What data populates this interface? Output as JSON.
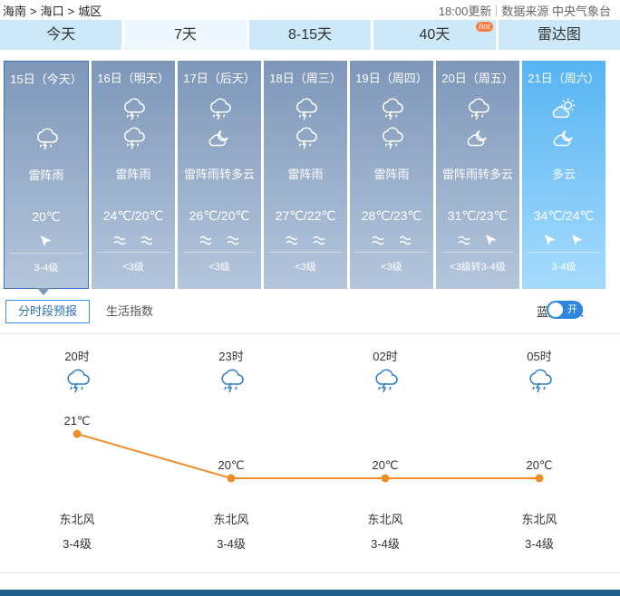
{
  "breadcrumb": {
    "province": "海南",
    "city": "海口",
    "district": "城区",
    "separator": ">"
  },
  "meta": {
    "updated": "18:00更新",
    "source": "数据来源 中央气象台"
  },
  "tabs": [
    {
      "label": "今天",
      "active": false
    },
    {
      "label": "7天",
      "active": true
    },
    {
      "label": "8-15天",
      "active": false
    },
    {
      "label": "40天",
      "active": false,
      "badge": "hot"
    },
    {
      "label": "雷达图",
      "active": false
    }
  ],
  "days": [
    {
      "date": "15日（今天）",
      "icons": [
        "thunder-rain-icon"
      ],
      "desc": "雷阵雨",
      "temp": "20℃",
      "winds": [
        "wind-arrow-icon"
      ],
      "level": "3-4级",
      "selected": true,
      "fine": false
    },
    {
      "date": "16日（明天）",
      "icons": [
        "thunder-rain-icon",
        "thunder-rain-icon"
      ],
      "desc": "雷阵雨",
      "temp": "24℃/20℃",
      "winds": [
        "wind-wave-icon",
        "wind-wave-icon"
      ],
      "level": "<3级",
      "selected": false,
      "fine": false
    },
    {
      "date": "17日（后天）",
      "icons": [
        "thunder-rain-icon",
        "cloud-moon-icon"
      ],
      "desc": "雷阵雨转多云",
      "temp": "26℃/20℃",
      "winds": [
        "wind-wave-icon",
        "wind-wave-icon"
      ],
      "level": "<3级",
      "selected": false,
      "fine": false
    },
    {
      "date": "18日（周三）",
      "icons": [
        "thunder-rain-icon",
        "thunder-rain-icon"
      ],
      "desc": "雷阵雨",
      "temp": "27℃/22℃",
      "winds": [
        "wind-wave-icon",
        "wind-wave-icon"
      ],
      "level": "<3级",
      "selected": false,
      "fine": false
    },
    {
      "date": "19日（周四）",
      "icons": [
        "thunder-rain-icon",
        "thunder-rain-icon"
      ],
      "desc": "雷阵雨",
      "temp": "28℃/23℃",
      "winds": [
        "wind-wave-icon",
        "wind-wave-icon"
      ],
      "level": "<3级",
      "selected": false,
      "fine": false
    },
    {
      "date": "20日（周五）",
      "icons": [
        "thunder-rain-icon",
        "cloud-moon-icon"
      ],
      "desc": "雷阵雨转多云",
      "temp": "31℃/23℃",
      "winds": [
        "wind-wave-icon",
        "wind-arrow-icon"
      ],
      "level": "<3级转3-4级",
      "selected": false,
      "fine": false
    },
    {
      "date": "21日（周六）",
      "icons": [
        "cloud-sun-icon",
        "cloud-moon-icon"
      ],
      "desc": "多云",
      "temp": "34℃/24℃",
      "winds": [
        "wind-arrow-icon",
        "wind-arrow-icon"
      ],
      "level": "3-4级",
      "selected": false,
      "fine": true
    }
  ],
  "subtabs": {
    "active": "分时段预报",
    "other": "生活指数"
  },
  "bluesky": {
    "label": "蓝天预报",
    "toggle": "开"
  },
  "hourly": [
    {
      "time": "20时",
      "icon": "thunder-rain-icon",
      "temp": 21,
      "temp_label": "21℃",
      "wind": "东北风",
      "level": "3-4级"
    },
    {
      "time": "23时",
      "icon": "thunder-rain-icon",
      "temp": 20,
      "temp_label": "20℃",
      "wind": "东北风",
      "level": "3-4级"
    },
    {
      "time": "02时",
      "icon": "thunder-rain-icon",
      "temp": 20,
      "temp_label": "20℃",
      "wind": "东北风",
      "level": "3-4级"
    },
    {
      "time": "05时",
      "icon": "thunder-rain-icon",
      "temp": 20,
      "temp_label": "20℃",
      "wind": "东北风",
      "level": "3-4级"
    }
  ],
  "colors": {
    "line": "#f08c2a",
    "tab": "#cde8f9",
    "tab_active": "#eef7fd",
    "day_bg": "#93a9c8",
    "day_fine": "#64bdf5",
    "accent": "#2f86e0"
  }
}
